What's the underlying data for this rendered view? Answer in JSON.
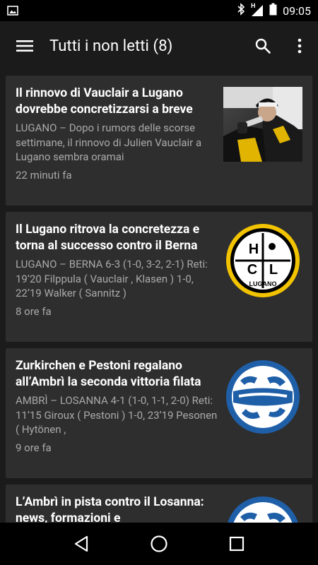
{
  "status_bar": {
    "time": "09:05",
    "network_label": "H",
    "icons": [
      "image-notification-icon",
      "bluetooth-icon",
      "signal-icon",
      "battery-icon"
    ]
  },
  "app_bar": {
    "title": "Tutti i non letti (8)",
    "icons": [
      "menu-icon",
      "search-icon",
      "overflow-menu-icon"
    ]
  },
  "articles": [
    {
      "title": "Il rinnovo di Vauclair a Lugano dovrebbe concretizzarsi a breve",
      "excerpt": "LUGANO – Dopo i rumors delle scorse settimane, il rinnovo di Julien Vauclair a Lugano sembra oramai",
      "time": "22 minuti fa",
      "thumbnail": "hockey-player-photo"
    },
    {
      "title": "Il Lugano ritrova la concretezza e torna al successo contro il Berna",
      "excerpt": "LUGANO – BERNA 6-3 (1-0, 3-2, 2-1) Reti: 19’20 Filppula ( Vauclair , Klasen ) 1-0, 22’19 Walker ( Sannitz )",
      "time": "8 ore fa",
      "thumbnail": "hc-lugano-logo",
      "logo_text": {
        "h": "H",
        "c": "C",
        "l": "L",
        "name": "LUGANO"
      }
    },
    {
      "title": "Zurkirchen e Pestoni regalano all’Ambrì la seconda vittoria filata",
      "excerpt": "AMBRÌ – LOSANNA 4-1 (1-0, 1-1, 2-0) Reti: 11’15 Giroux ( Pestoni ) 1-0, 23’19 Pesonen ( Hytönen ,",
      "time": "9 ore fa",
      "thumbnail": "hcap-logo"
    },
    {
      "title": "L’Ambrì in pista contro il Losanna: news, formazioni e",
      "excerpt": "",
      "time": "",
      "thumbnail": "hcap-logo"
    }
  ],
  "nav_bar": {
    "icons": [
      "back-icon",
      "home-icon",
      "recents-icon"
    ]
  },
  "colors": {
    "background": "#1b1b1b",
    "card": "#2e2e2e",
    "secondary_text": "#a9a9a9",
    "hcap_blue": "#1f5fa8",
    "lugano_yellow": "#f2c300"
  }
}
